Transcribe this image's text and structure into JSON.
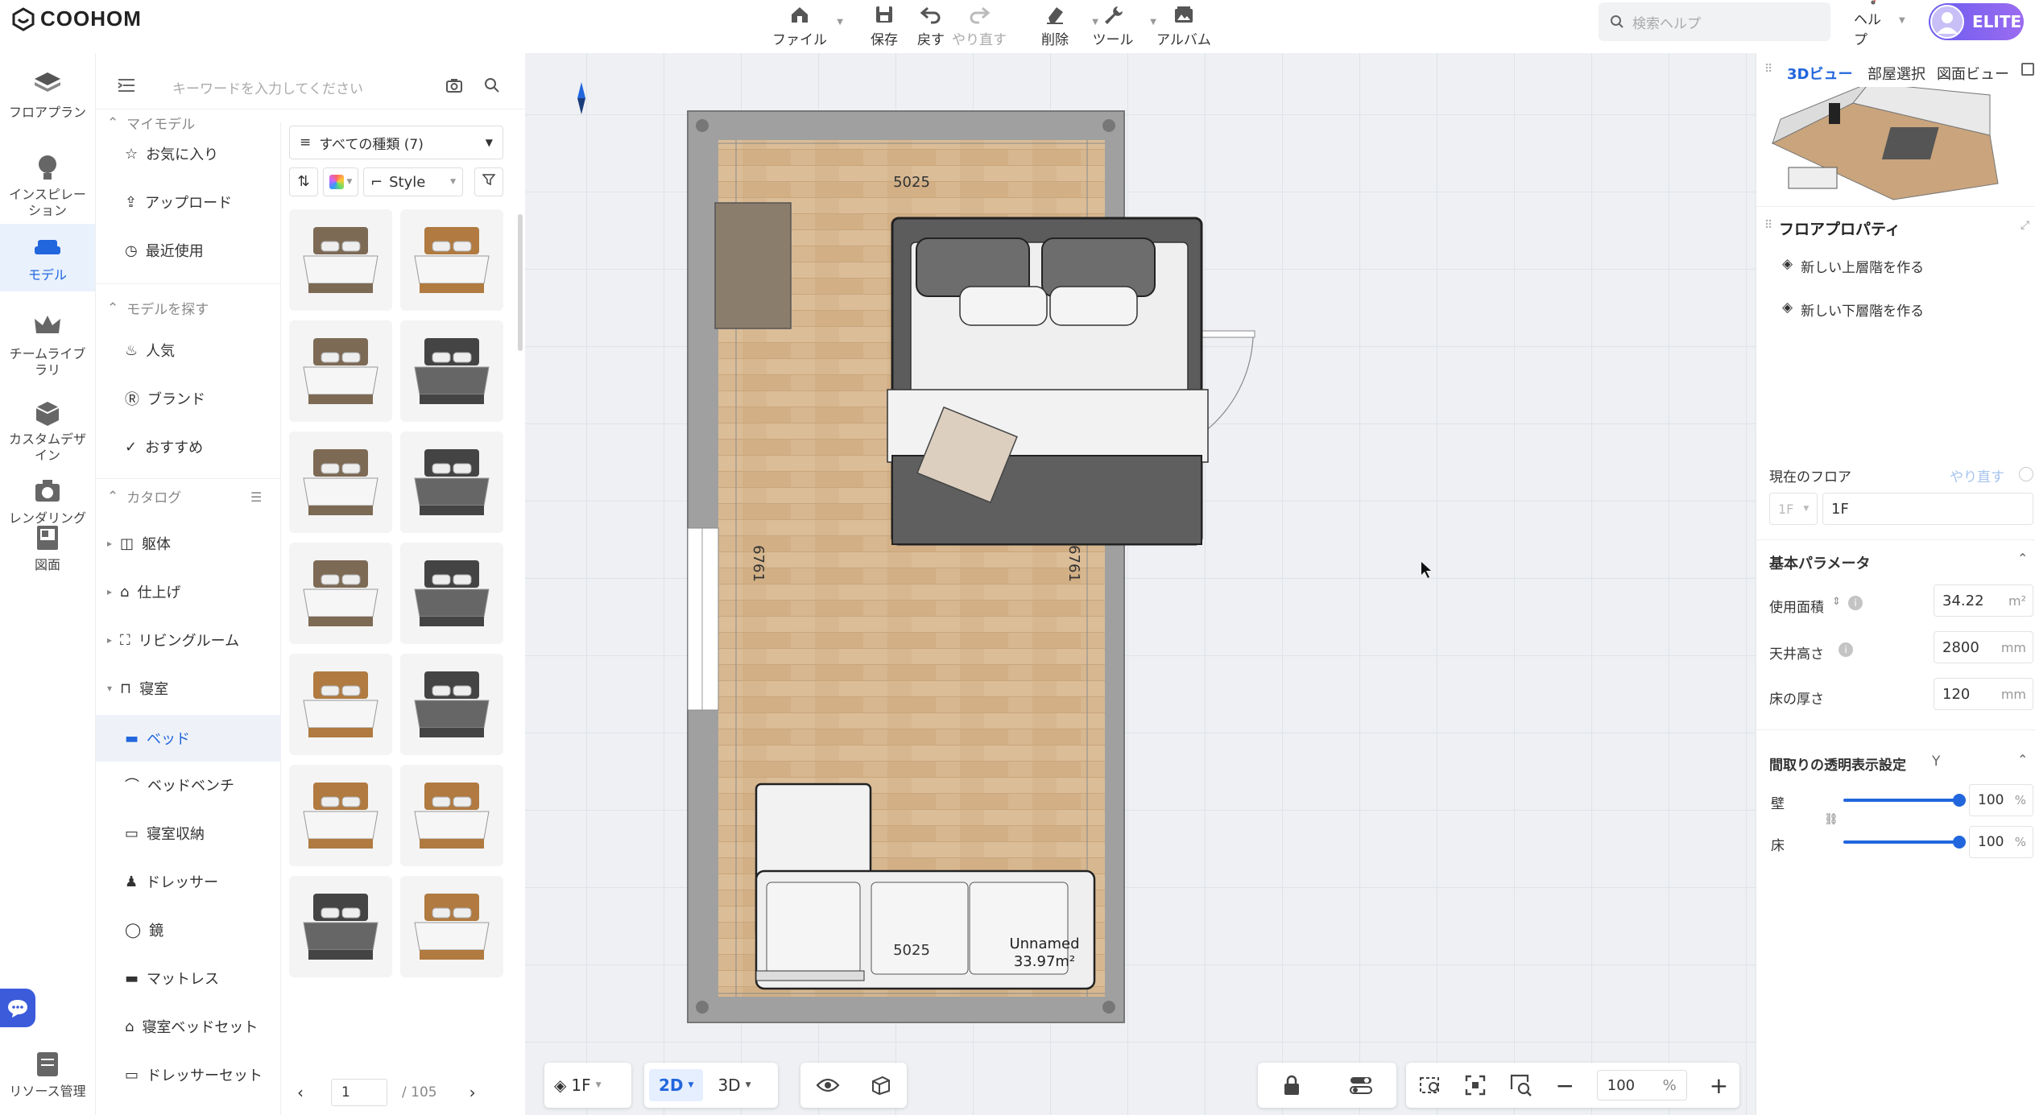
{
  "app": {
    "logo": "COOHOM"
  },
  "toolbar": [
    {
      "name": "file",
      "label": "ファイル",
      "icon": "home-icon",
      "caret": true,
      "enabled": true
    },
    {
      "name": "save",
      "label": "保存",
      "icon": "save-icon",
      "caret": false,
      "enabled": true
    },
    {
      "name": "undo",
      "label": "戻す",
      "icon": "undo-icon",
      "caret": false,
      "enabled": true
    },
    {
      "name": "redo",
      "label": "やり直す",
      "icon": "redo-icon",
      "caret": false,
      "enabled": false
    },
    {
      "name": "delete",
      "label": "削除",
      "icon": "eraser-icon",
      "caret": true,
      "enabled": true
    },
    {
      "name": "tools",
      "label": "ツール",
      "icon": "wrench-icon",
      "caret": true,
      "enabled": true
    },
    {
      "name": "album",
      "label": "アルバム",
      "icon": "album-icon",
      "caret": false,
      "enabled": true
    }
  ],
  "header": {
    "search_placeholder": "検索ヘルプ",
    "help_label": "ヘルプ",
    "elite_label": "ELITE"
  },
  "rail": [
    {
      "name": "floorplan",
      "label": "フロアプラン",
      "icon": "floorplan-icon"
    },
    {
      "name": "inspiration",
      "label": "インスピレーション",
      "icon": "bulb-icon"
    },
    {
      "name": "model",
      "label": "モデル",
      "icon": "sofa-icon",
      "active": true
    },
    {
      "name": "team-library",
      "label": "チームライブラリ",
      "icon": "crown-icon"
    },
    {
      "name": "custom-design",
      "label": "カスタムデザイン",
      "icon": "box-icon"
    },
    {
      "name": "rendering",
      "label": "レンダリング",
      "icon": "camera-icon"
    },
    {
      "name": "drawing",
      "label": "図面",
      "icon": "drawing-icon"
    },
    {
      "name": "resource",
      "label": "リソース管理",
      "icon": "resource-icon"
    }
  ],
  "panel": {
    "search_placeholder": "キーワードを入力してください",
    "my_models": "マイモデル",
    "favorites": "お気に入り",
    "upload": "アップロード",
    "recent": "最近使用",
    "find_models": "モデルを探す",
    "popular": "人気",
    "brand": "ブランド",
    "recommended": "おすすめ",
    "catalog": "カタログ",
    "catalog_items": [
      "躯体",
      "仕上げ",
      "リビングルーム",
      "寝室"
    ],
    "bedroom_items": [
      "ベッド",
      "ベッドベンチ",
      "寝室収納",
      "ドレッサー",
      "鏡",
      "マットレス",
      "寝室ベッドセット",
      "ドレッサーセット"
    ],
    "type_filter": "すべての種類 (7)",
    "style_label": "Style",
    "page_current": "1",
    "page_total": "/ 105"
  },
  "plan": {
    "top_dim": "5025",
    "bottom_dim": "5025",
    "left_dim": "6761",
    "right_dim": "6761",
    "room_name": "Unnamed",
    "room_area": "33.97m²"
  },
  "right": {
    "tabs": [
      "3Dビュー",
      "部屋選択",
      "図面ビュー"
    ],
    "title": "フロアプロパティ",
    "new_upper": "新しい上層階を作る",
    "new_lower": "新しい下層階を作る",
    "current_floor_label": "現在のフロア",
    "redo_link": "やり直す",
    "floor_select": "1F",
    "floor_name": "1F",
    "basic_params": "基本パラメータ",
    "area_label": "使用面積",
    "area_value": "34.22",
    "area_unit": "m²",
    "ceiling_label": "天井高さ",
    "ceiling_value": "2800",
    "ceiling_unit": "mm",
    "floor_thick_label": "床の厚さ",
    "floor_thick_value": "120",
    "floor_thick_unit": "mm",
    "transparency_title": "間取りの透明表示設定",
    "transparency_key": "Y",
    "wall_label": "壁",
    "wall_value": "100",
    "floor_label": "床",
    "floor_value": "100",
    "percent": "%",
    "wall_level": 1.0,
    "floor_level": 1.0
  },
  "bottom": {
    "floor": "1F",
    "mode_2d": "2D",
    "mode_3d": "3D",
    "zoom": "100",
    "zoom_unit": "%"
  },
  "colors": {
    "accent": "#2266dd",
    "wall": "#9e9e9e",
    "floor": "#d4b48c",
    "elite": "#7b62f0"
  }
}
